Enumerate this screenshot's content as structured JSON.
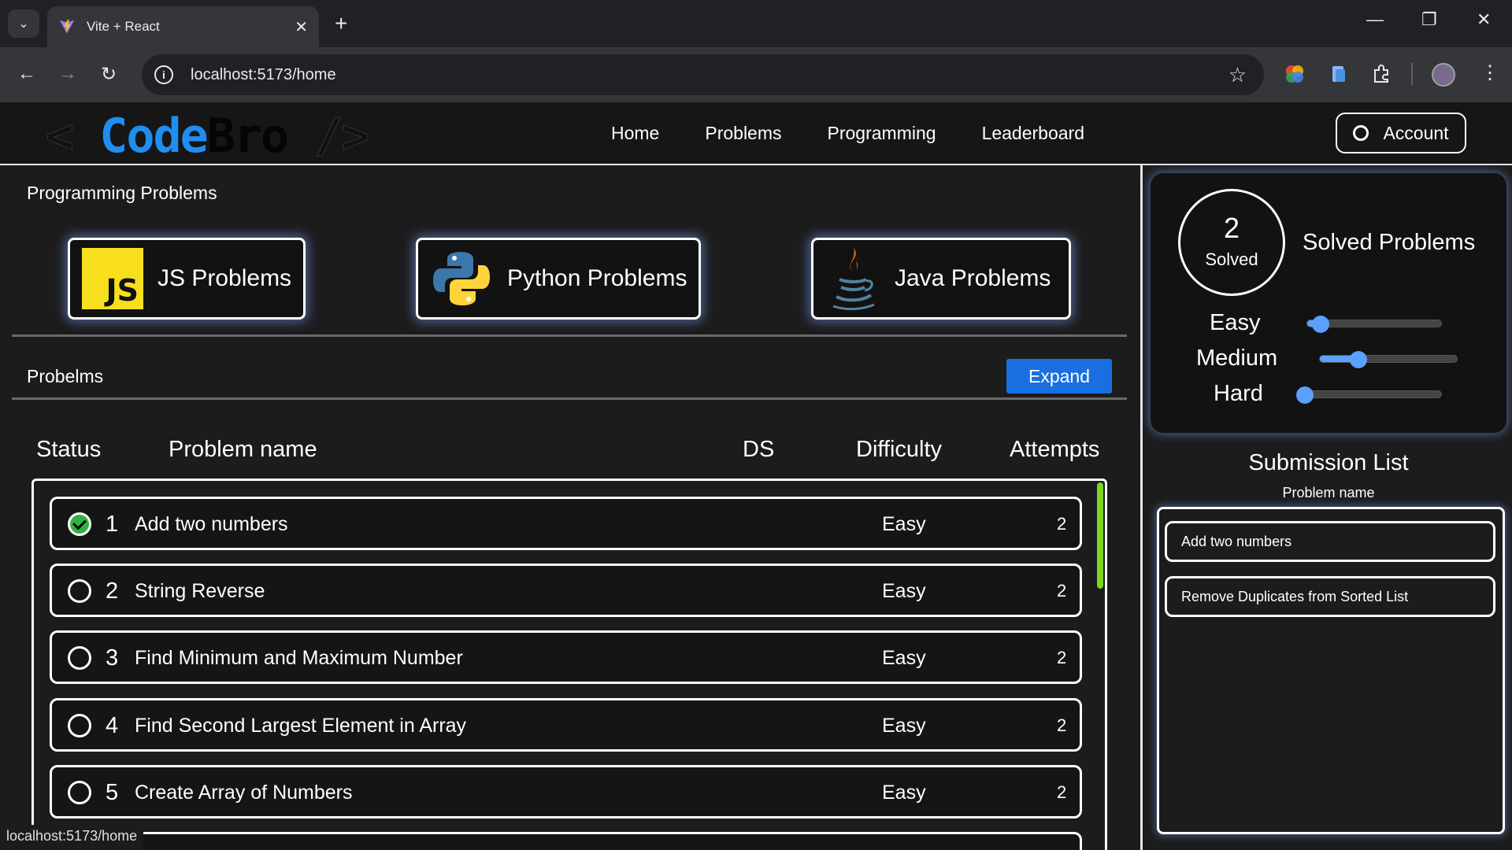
{
  "browser": {
    "tab_title": "Vite + React",
    "url": "localhost:5173/home",
    "status_url": "localhost:5173/home"
  },
  "navbar": {
    "logo_left": "< ",
    "logo_code": "Code",
    "logo_bro": "Bro",
    "logo_right": " />",
    "links": [
      "Home",
      "Problems",
      "Programming",
      "Leaderboard"
    ],
    "account_label": "Account"
  },
  "main": {
    "section_title": "Programming Problems",
    "languages": [
      {
        "label": "JS Problems",
        "icon": "javascript-logo-icon"
      },
      {
        "label": "Python Problems",
        "icon": "python-logo-icon"
      },
      {
        "label": "Java Problems",
        "icon": "java-logo-icon"
      }
    ],
    "problems_label": "Probelms",
    "expand_label": "Expand",
    "columns": [
      "Status",
      "Problem name",
      "DS",
      "Difficulty",
      "Attempts"
    ],
    "rows": [
      {
        "num": "1",
        "name": "Add two numbers",
        "difficulty": "Easy",
        "attempts": "2",
        "solved": true
      },
      {
        "num": "2",
        "name": "String Reverse",
        "difficulty": "Easy",
        "attempts": "2",
        "solved": false
      },
      {
        "num": "3",
        "name": "Find Minimum and Maximum Number",
        "difficulty": "Easy",
        "attempts": "2",
        "solved": false
      },
      {
        "num": "4",
        "name": "Find Second Largest Element in Array",
        "difficulty": "Easy",
        "attempts": "2",
        "solved": false
      },
      {
        "num": "5",
        "name": "Create Array of Numbers",
        "difficulty": "Easy",
        "attempts": "2",
        "solved": false
      }
    ]
  },
  "sidebar": {
    "solved_count": "2",
    "solved_label": "Solved",
    "solved_title": "Solved Problems",
    "difficulty": [
      {
        "label": "Easy",
        "level": 0.1
      },
      {
        "label": "Medium",
        "level": 0.28
      },
      {
        "label": "Hard",
        "level": 0.02
      }
    ],
    "submission_title": "Submission List",
    "submission_subtitle": "Problem name",
    "submissions": [
      "Add two numbers",
      "Remove Duplicates from Sorted List"
    ]
  },
  "colors": {
    "accent": "#1a6fe0",
    "logo_blue": "#1f8ef1",
    "solved_green": "#2fb344",
    "scroll_green": "#7ed321"
  }
}
